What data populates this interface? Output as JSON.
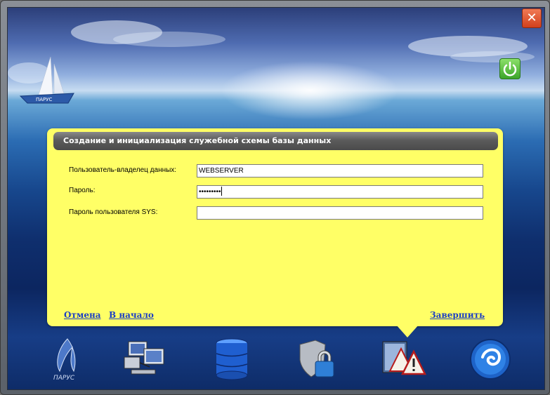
{
  "window": {
    "close_glyph": "✕"
  },
  "header": {
    "title": "Создание и инициализация служебной схемы базы данных"
  },
  "form": {
    "owner_label": "Пользователь-владелец данных:",
    "owner_value": "WEBSERVER",
    "password_label": "Пароль:",
    "password_mask": "•••••••••",
    "sys_password_label": "Пароль пользователя SYS:",
    "sys_password_value": ""
  },
  "links": {
    "cancel": "Отмена",
    "home": "В начало",
    "finish": "Завершить"
  },
  "branding": {
    "logo_text": "ПАРУС",
    "boat_text": "ПАРУС"
  },
  "icons": [
    "parus-logo-icon",
    "network-computers-icon",
    "database-icon",
    "shield-lock-icon",
    "warning-window-icon",
    "parus-globe-icon"
  ],
  "colors": {
    "panel_bg": "#ffff66",
    "link": "#1c3fc4",
    "header_bg": "#5c5c5c",
    "close": "#d2401c",
    "power": "#3ca52a"
  }
}
